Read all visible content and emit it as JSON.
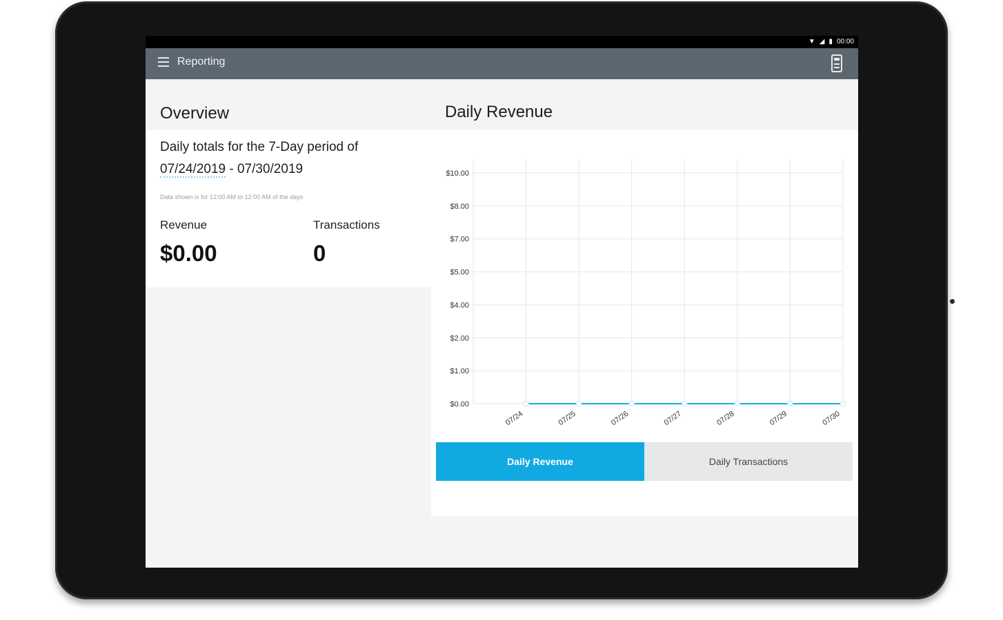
{
  "colors": {
    "device_bezel": "#141414",
    "app_bar": "#5c6770",
    "accent": "#11a9e1",
    "page_background": "#f3f4f6"
  },
  "status_bar": {
    "time": "00:00",
    "icons": [
      "wifi-icon",
      "signal-icon",
      "battery-icon"
    ]
  },
  "app_bar": {
    "title": "Reporting",
    "menu_icon": "hamburger-menu-icon",
    "action_icon": "printer-icon"
  },
  "overview": {
    "title": "Overview",
    "period_text": "Daily totals for the 7-Day period of",
    "period_start": "07/24/2019",
    "period_separator": " - ",
    "period_end": "07/30/2019",
    "note": "Data shown is for 12:00 AM to 12:00 AM of the days",
    "revenue_label": "Revenue",
    "revenue_value": "$0.00",
    "transactions_label": "Transactions",
    "transactions_value": "0"
  },
  "chart_panel": {
    "title": "Daily Revenue",
    "toggle": {
      "active_label": "Daily Revenue",
      "inactive_label": "Daily Transactions"
    }
  },
  "chart_data": {
    "type": "line",
    "title": "Daily Revenue",
    "x": [
      "07/24",
      "07/25",
      "07/26",
      "07/27",
      "07/28",
      "07/29",
      "07/30"
    ],
    "y_tick_labels": [
      "$0.00",
      "$1.00",
      "$2.00",
      "$4.00",
      "$5.00",
      "$7.00",
      "$8.00",
      "$10.00"
    ],
    "series": [
      {
        "values": [
          0,
          0,
          0,
          0,
          0,
          0,
          0
        ],
        "color": "#11a9e1"
      }
    ],
    "grid": true,
    "xlabel": "",
    "ylabel": ""
  }
}
